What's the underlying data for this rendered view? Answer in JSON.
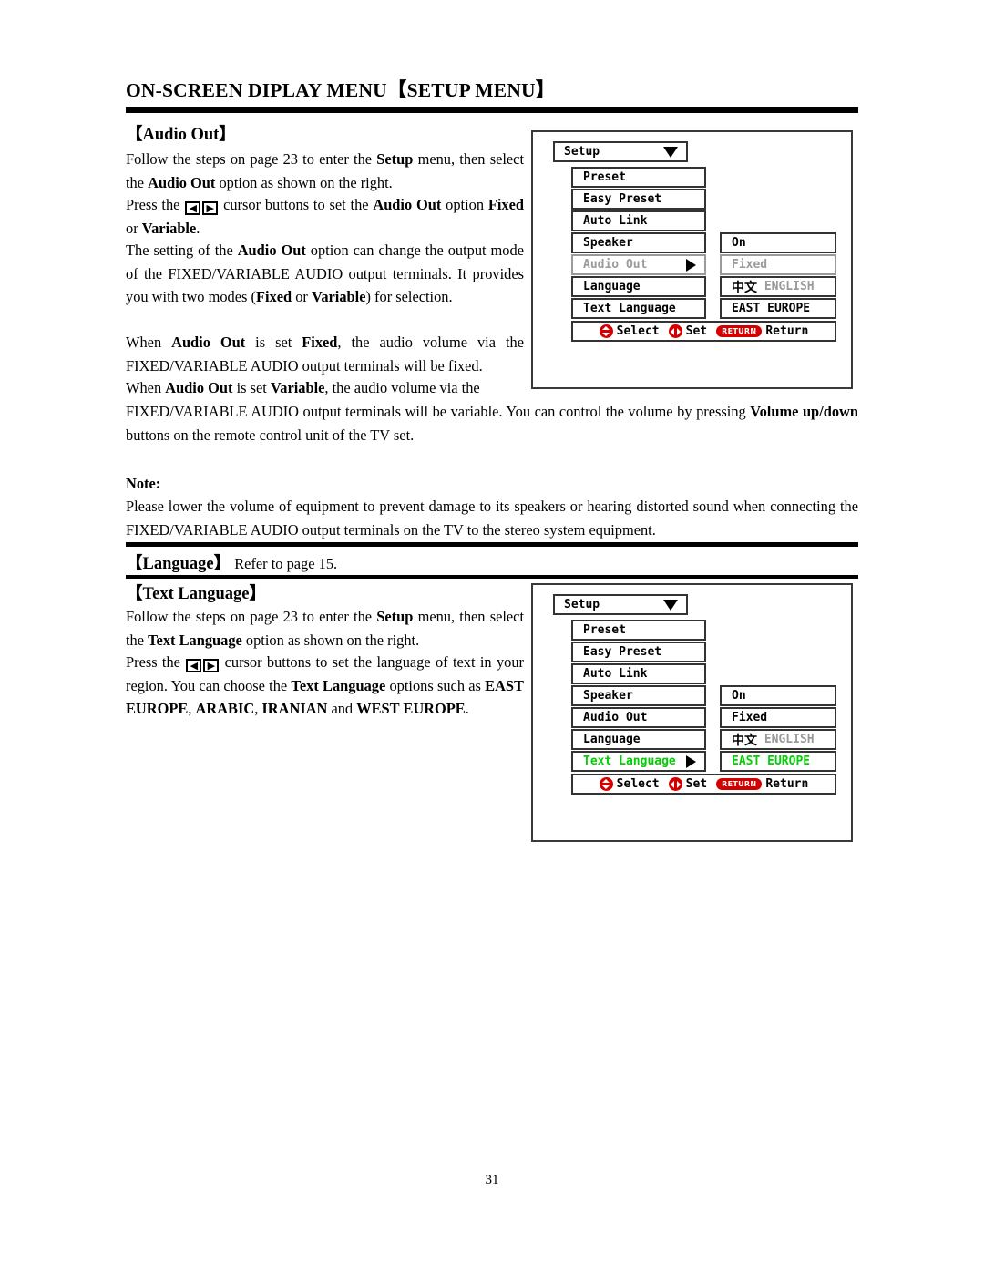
{
  "document": {
    "title": "ON-SCREEN DIPLAY MENU【SETUP MENU】",
    "page_number": "31"
  },
  "sections": {
    "audio_out": {
      "heading": "【Audio Out】",
      "para1_a": "Follow the steps on page 23 to enter the ",
      "para1_b": "Setup",
      "para1_c": " menu, then select the ",
      "para1_d": "Audio Out",
      "para1_e": " option as shown on the right.",
      "para2_a": "Press the ",
      "para2_key_left": "◀",
      "para2_key_right": "▶",
      "para2_b": " cursor buttons to set the ",
      "para2_c": "Audio Out",
      "para2_d": " option ",
      "para2_e": "Fixed",
      "para2_f": " or ",
      "para2_g": "Variable",
      "para2_h": ".",
      "para3_a": "The setting of the ",
      "para3_b": "Audio Out",
      "para3_c": " option can change the output mode of the FIXED/VARIABLE AUDIO output terminals. It provides you with two modes (",
      "para3_d": "Fixed",
      "para3_e": " or ",
      "para3_f": "Variable",
      "para3_g": ") for selection.",
      "para4_a": "When ",
      "para4_b": "Audio Out",
      "para4_c": " is set ",
      "para4_d": "Fixed",
      "para4_e": ", the audio volume via the FIXED/VARIABLE AUDIO output terminals will be fixed.",
      "para5_a": "When ",
      "para5_b": "Audio Out",
      "para5_c": " is set ",
      "para5_d": "Variable",
      "para5_e": ", the audio volume via the",
      "para6_a": "FIXED/VARIABLE AUDIO output terminals will be variable. You can control the volume by pressing ",
      "para6_b": "Volume up/down",
      "para6_c": " buttons on the remote control unit of the TV set."
    },
    "note": {
      "label": "Note:",
      "text": "Please lower the volume of equipment to prevent damage to its speakers or hearing distorted sound when connecting the FIXED/VARIABLE AUDIO output terminals on the TV to the stereo system equipment."
    },
    "language": {
      "label": "【Language】",
      "text": " Refer to page 15."
    },
    "text_language": {
      "heading": "【Text Language】",
      "para1_a": "Follow the steps on page 23 to enter the ",
      "para1_b": "Setup",
      "para1_c": " menu, then select the ",
      "para1_d": "Text Language",
      "para1_e": " option as shown on the right.",
      "para2_a": "Press the ",
      "para2_key_left": "◀",
      "para2_key_right": "▶",
      "para2_b": " cursor buttons to set the language of text in your region. You can choose the ",
      "para2_c": "Text Language",
      "para2_d": " options such as ",
      "para2_e": "EAST EUROPE",
      "para2_f": ", ",
      "para2_g": "ARABIC",
      "para2_h": ", ",
      "para2_i": "IRANIAN",
      "para2_j": " and ",
      "para2_k": "WEST EUROPE",
      "para2_l": "."
    }
  },
  "osd_menu_1": {
    "title": "Setup",
    "items": [
      {
        "label": "Preset",
        "value": null
      },
      {
        "label": "Easy Preset",
        "value": null
      },
      {
        "label": "Auto Link",
        "value": null
      },
      {
        "label": "Speaker",
        "value": "On"
      },
      {
        "label": "Audio Out",
        "value": "Fixed"
      },
      {
        "label": "Language",
        "value_cn": "中文",
        "value_en": "ENGLISH"
      },
      {
        "label": "Text Language",
        "value": "EAST EUROPE"
      }
    ],
    "selected_index": 4,
    "selected_state": "dimmed",
    "hint": {
      "select": "Select",
      "set": "Set",
      "return_badge": "RETURN",
      "return": "Return"
    }
  },
  "osd_menu_2": {
    "title": "Setup",
    "items": [
      {
        "label": "Preset",
        "value": null
      },
      {
        "label": "Easy Preset",
        "value": null
      },
      {
        "label": "Auto Link",
        "value": null
      },
      {
        "label": "Speaker",
        "value": "On"
      },
      {
        "label": "Audio Out",
        "value": "Fixed"
      },
      {
        "label": "Language",
        "value_cn": "中文",
        "value_en": "ENGLISH"
      },
      {
        "label": "Text Language",
        "value": "EAST EUROPE"
      }
    ],
    "selected_index": 6,
    "selected_state": "highlighted-green",
    "hint": {
      "select": "Select",
      "set": "Set",
      "return_badge": "RETURN",
      "return": "Return"
    }
  },
  "colors": {
    "highlight_green": "#00d000",
    "dim_gray": "#9a9a9a",
    "icon_red": "#d40000",
    "ink": "#000000"
  }
}
